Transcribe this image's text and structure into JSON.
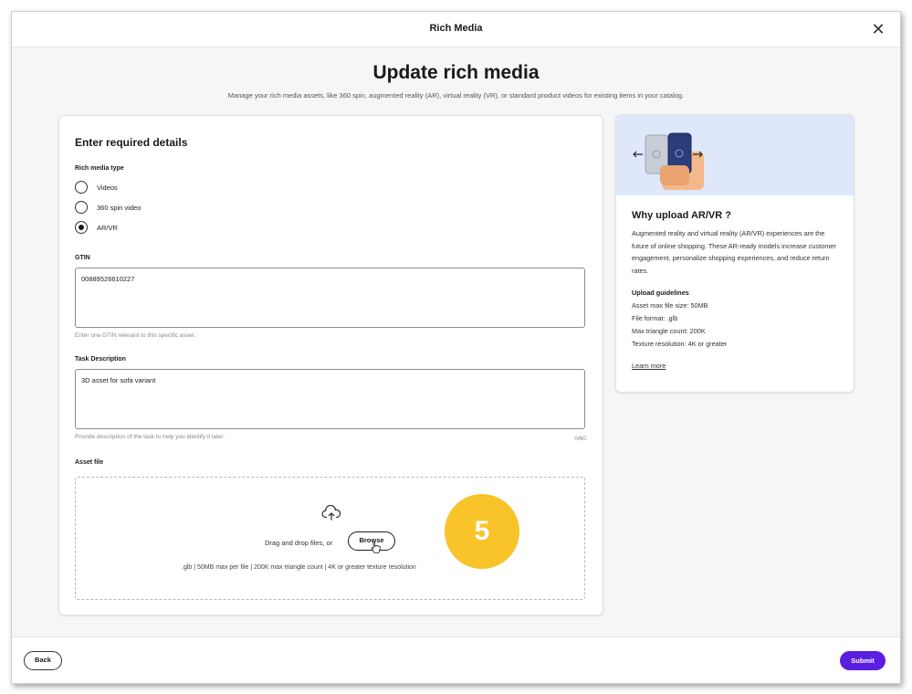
{
  "modal": {
    "title": "Rich Media"
  },
  "page": {
    "heading": "Update rich media",
    "subheading": "Manage your rich media assets, like 360 spin, augmented reality (AR), virtual reality (VR), or standard product videos for existing items in your catalog."
  },
  "form": {
    "card_title": "Enter required details",
    "media_type": {
      "label": "Rich media type",
      "options": [
        "Videos",
        "360 spin video",
        "AR/VR"
      ],
      "selected": "AR/VR"
    },
    "gtin": {
      "label": "GTIN",
      "value": "00889526610227",
      "helper": "Enter one GTIN relevant to this specific asset."
    },
    "task": {
      "label": "Task Description",
      "value": "3D asset for sofa variant",
      "helper": "Provide description of the task to help you identify it later.",
      "counter": "0/60"
    },
    "asset": {
      "label": "Asset file",
      "drag_text": "Drag and drop files, or",
      "browse_label": "Browse",
      "formats": ".glb | 50MB max per file | 200K max triangle count | 4K or greater texture resolution"
    }
  },
  "step_badge": "5",
  "info": {
    "title": "Why upload AR/VR ?",
    "body": "Augmented reality and virtual reality (AR/VR) experiences are the future of online shopping. These AR-ready models increase customer engagement, personalize shopping experiences, and reduce return rates.",
    "guidelines_title": "Upload guidelines",
    "guidelines": [
      "Asset max file size: 50MB",
      "File format: .glb",
      "Max triangle count: 200K",
      "Texture resolution: 4K or greater"
    ],
    "learn_more": "Learn more"
  },
  "footer": {
    "back_label": "Back",
    "submit_label": "Submit"
  },
  "colors": {
    "accent": "#5a1ee0",
    "badge": "#f9c32a",
    "hero": "#dfe8fb"
  },
  "icons": [
    "close-icon",
    "upload-cloud-icon",
    "pointer-cursor-icon",
    "phone-illustration",
    "arrow-left-icon",
    "arrow-right-icon"
  ]
}
